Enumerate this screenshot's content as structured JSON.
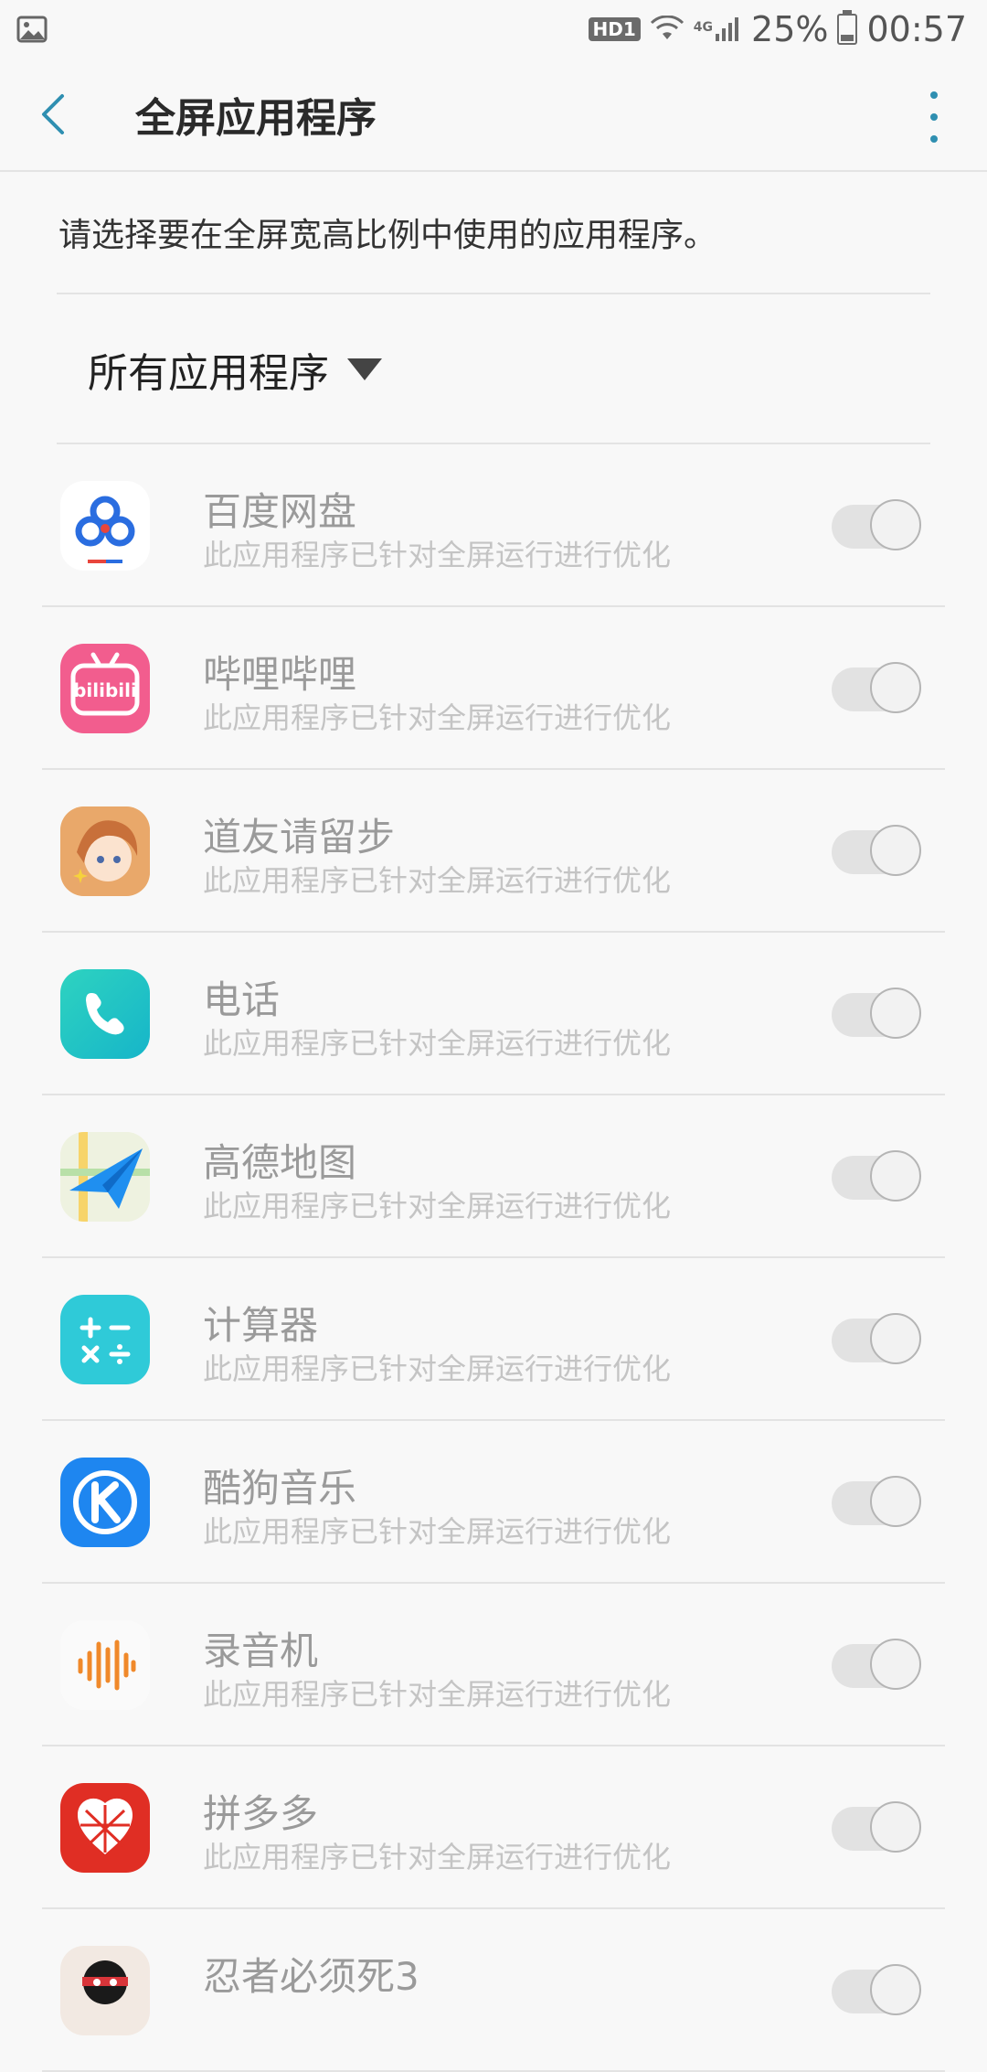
{
  "status_bar": {
    "signal_badge": "HD1",
    "network": "4G",
    "battery_percent": "25%",
    "time": "00:57",
    "battery_level": 0.25
  },
  "header": {
    "title": "全屏应用程序"
  },
  "description": "请选择要在全屏宽高比例中使用的应用程序。",
  "filter": {
    "selected": "所有应用程序"
  },
  "apps": [
    {
      "name": "百度网盘",
      "subtitle": "此应用程序已针对全屏运行进行优化",
      "enabled": true,
      "icon": "baidu-netdisk-icon"
    },
    {
      "name": "哔哩哔哩",
      "subtitle": "此应用程序已针对全屏运行进行优化",
      "enabled": true,
      "icon": "bilibili-icon"
    },
    {
      "name": "道友请留步",
      "subtitle": "此应用程序已针对全屏运行进行优化",
      "enabled": true,
      "icon": "game-avatar-icon"
    },
    {
      "name": "电话",
      "subtitle": "此应用程序已针对全屏运行进行优化",
      "enabled": true,
      "icon": "phone-icon"
    },
    {
      "name": "高德地图",
      "subtitle": "此应用程序已针对全屏运行进行优化",
      "enabled": true,
      "icon": "amap-icon"
    },
    {
      "name": "计算器",
      "subtitle": "此应用程序已针对全屏运行进行优化",
      "enabled": true,
      "icon": "calculator-icon"
    },
    {
      "name": "酷狗音乐",
      "subtitle": "此应用程序已针对全屏运行进行优化",
      "enabled": true,
      "icon": "kugou-icon"
    },
    {
      "name": "录音机",
      "subtitle": "此应用程序已针对全屏运行进行优化",
      "enabled": true,
      "icon": "voice-recorder-icon"
    },
    {
      "name": "拼多多",
      "subtitle": "此应用程序已针对全屏运行进行优化",
      "enabled": true,
      "icon": "pinduoduo-icon"
    },
    {
      "name": "忍者必须死3",
      "subtitle": "",
      "enabled": true,
      "icon": "ninja-icon"
    }
  ],
  "colors": {
    "accent": "#2f8fb1",
    "background": "#f8f8f8",
    "app_name": "#9a9a9a",
    "app_subtitle": "#c4c4c4"
  }
}
